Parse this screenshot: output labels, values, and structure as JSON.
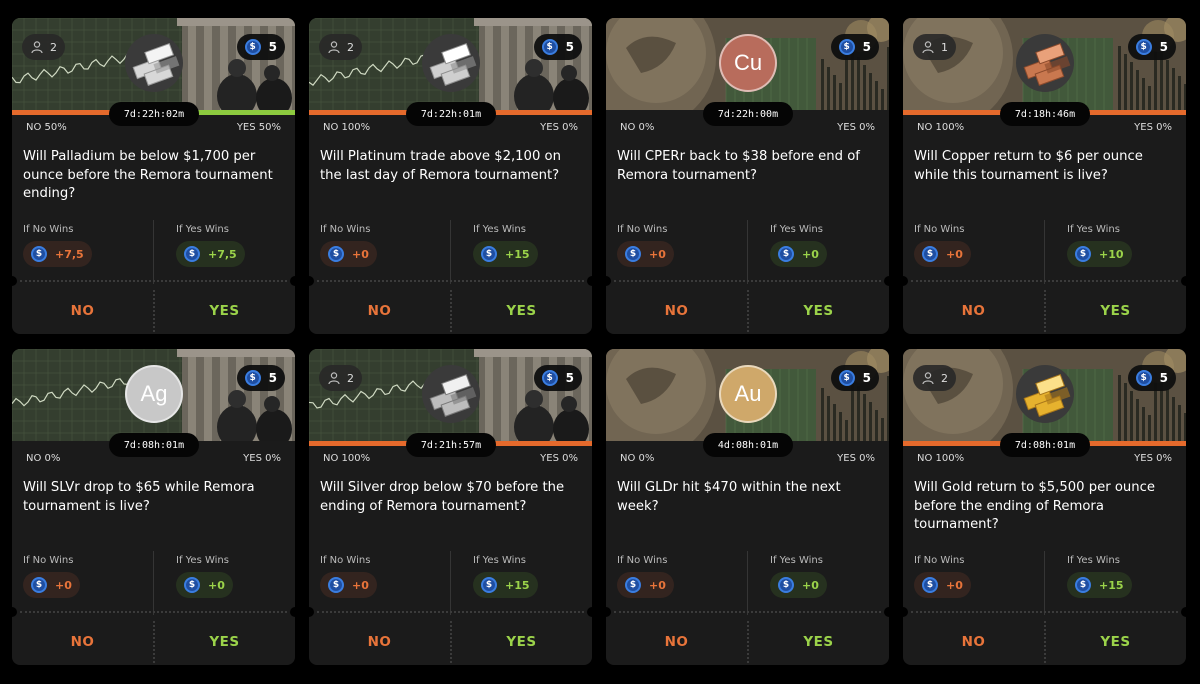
{
  "colors": {
    "no": "#e8743a",
    "yes": "#9bd34a",
    "bar_no": "#e56a2c",
    "bar_yes": "#8dca3f",
    "card": "#1b1b1b",
    "coin": "#1f4ea1"
  },
  "labels": {
    "if_no": "If No Wins",
    "if_yes": "If Yes Wins",
    "no_button": "NO",
    "yes_button": "YES"
  },
  "cards": [
    {
      "players": "2",
      "cost": "5",
      "avatar": {
        "type": "image",
        "icon": "palladium-bars-icon",
        "text": ""
      },
      "yes_fraction": 0.5,
      "timer": "7d:22h:02m",
      "no_pct": "NO 50%",
      "yes_pct": "YES 50%",
      "question": "Will Palladium be below $1,700 per ounce before the Remora tournament ending?",
      "no_reward": "+7,5",
      "yes_reward": "+7,5",
      "banner": "city"
    },
    {
      "players": "2",
      "cost": "5",
      "avatar": {
        "type": "image",
        "icon": "platinum-bars-icon",
        "text": ""
      },
      "yes_fraction": 0,
      "timer": "7d:22h:01m",
      "no_pct": "NO 100%",
      "yes_pct": "YES 0%",
      "question": "Will Platinum trade above $2,100 on the last day of Remora tournament?",
      "no_reward": "+0",
      "yes_reward": "+15",
      "banner": "city"
    },
    {
      "players": "",
      "cost": "5",
      "avatar": {
        "type": "text",
        "icon": "",
        "text": "Cu"
      },
      "yes_fraction": 0,
      "timer": "7d:22h:00m",
      "no_pct": "NO 0%",
      "yes_pct": "YES 0%",
      "question": "Will CPERr back to $38 before end of Remora tournament?",
      "no_reward": "+0",
      "yes_reward": "+0",
      "banner": "globe"
    },
    {
      "players": "1",
      "cost": "5",
      "avatar": {
        "type": "image",
        "icon": "copper-bars-icon",
        "text": ""
      },
      "yes_fraction": 0,
      "timer": "7d:18h:46m",
      "no_pct": "NO 100%",
      "yes_pct": "YES 0%",
      "question": "Will Copper return to $6 per ounce while this tournament is live?",
      "no_reward": "+0",
      "yes_reward": "+10",
      "banner": "globe"
    },
    {
      "players": "",
      "cost": "5",
      "avatar": {
        "type": "text",
        "icon": "",
        "text": "Ag"
      },
      "yes_fraction": 0,
      "timer": "7d:08h:01m",
      "no_pct": "NO 0%",
      "yes_pct": "YES 0%",
      "question": "Will SLVr drop to $65 while Remora tournament is live?",
      "no_reward": "+0",
      "yes_reward": "+0",
      "banner": "city"
    },
    {
      "players": "2",
      "cost": "5",
      "avatar": {
        "type": "image",
        "icon": "silver-bars-icon",
        "text": ""
      },
      "yes_fraction": 0,
      "timer": "7d:21h:57m",
      "no_pct": "NO 100%",
      "yes_pct": "YES 0%",
      "question": "Will Silver drop below $70 before the ending of Remora tournament?",
      "no_reward": "+0",
      "yes_reward": "+15",
      "banner": "city"
    },
    {
      "players": "",
      "cost": "5",
      "avatar": {
        "type": "text",
        "icon": "",
        "text": "Au"
      },
      "yes_fraction": 0,
      "timer": "4d:08h:01m",
      "no_pct": "NO 0%",
      "yes_pct": "YES 0%",
      "question": "Will GLDr hit $470 within the next week?",
      "no_reward": "+0",
      "yes_reward": "+0",
      "banner": "globe"
    },
    {
      "players": "2",
      "cost": "5",
      "avatar": {
        "type": "image",
        "icon": "gold-bars-icon",
        "text": ""
      },
      "yes_fraction": 0,
      "timer": "7d:08h:01m",
      "no_pct": "NO 100%",
      "yes_pct": "YES 0%",
      "question": "Will Gold return to $5,500 per ounce before the ending of Remora tournament?",
      "no_reward": "+0",
      "yes_reward": "+15",
      "banner": "globe"
    }
  ]
}
